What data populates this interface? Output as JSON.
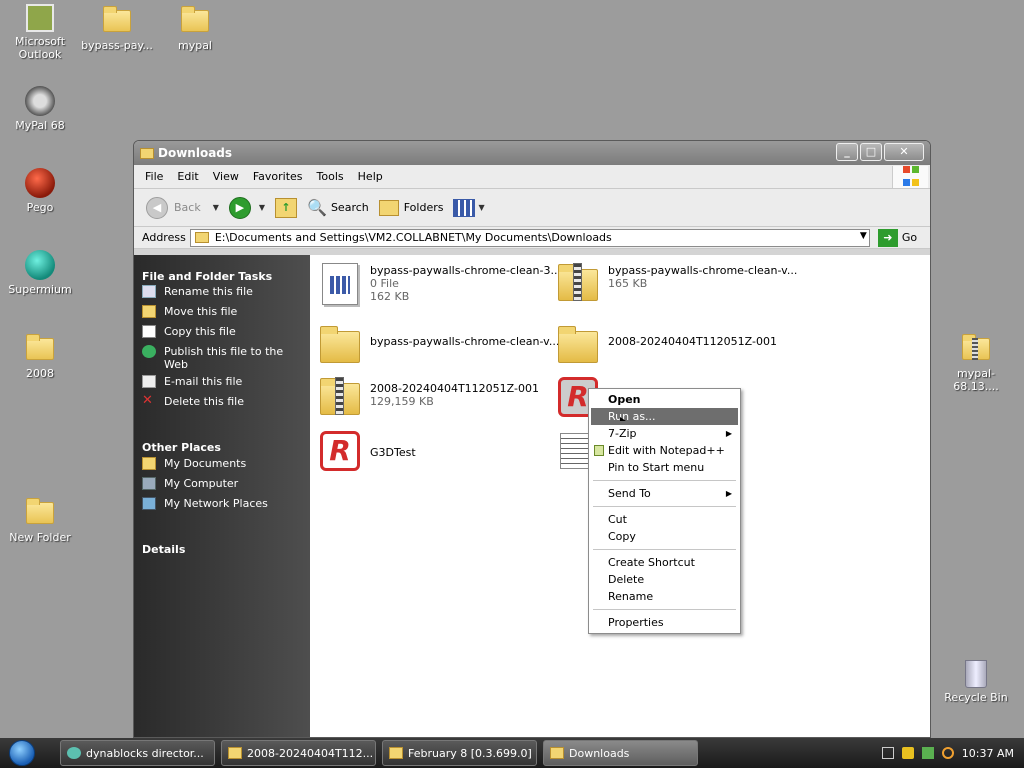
{
  "desktop": {
    "icons": [
      {
        "label": "Microsoft Outlook"
      },
      {
        "label": "bypass-pay..."
      },
      {
        "label": "mypal"
      },
      {
        "label": "MyPal 68"
      },
      {
        "label": "Pego"
      },
      {
        "label": "Supermium"
      },
      {
        "label": "2008"
      },
      {
        "label": "New Folder"
      },
      {
        "label": "mypal-68.13...."
      },
      {
        "label": "Recycle Bin"
      }
    ]
  },
  "window": {
    "title": "Downloads",
    "menu": [
      "File",
      "Edit",
      "View",
      "Favorites",
      "Tools",
      "Help"
    ],
    "toolbar": {
      "back": "Back",
      "search": "Search",
      "folders": "Folders"
    },
    "address": {
      "label": "Address",
      "value": "E:\\Documents and Settings\\VM2.COLLABNET\\My Documents\\Downloads",
      "go": "Go"
    },
    "sidebar": {
      "tasks_title": "File and Folder Tasks",
      "tasks": [
        "Rename this file",
        "Move this file",
        "Copy this file",
        "Publish this file to the Web",
        "E-mail this file",
        "Delete this file"
      ],
      "places_title": "Other Places",
      "places": [
        "My Documents",
        "My Computer",
        "My Network Places"
      ],
      "details_title": "Details"
    },
    "files": [
      {
        "name": "bypass-paywalls-chrome-clean-3....",
        "line2": "0 File",
        "line3": "162 KB"
      },
      {
        "name": "bypass-paywalls-chrome-clean-v...",
        "line2": "165 KB"
      },
      {
        "name": "bypass-paywalls-chrome-clean-v..."
      },
      {
        "name": "2008-20240404T112051Z-001"
      },
      {
        "name": "2008-20240404T112051Z-001",
        "line2": "129,159 KB"
      },
      {
        "name": "G3DTest"
      }
    ]
  },
  "context_menu": {
    "items": [
      "Open",
      "Run as...",
      "7-Zip",
      "Edit with Notepad++",
      "Pin to Start menu",
      "Send To",
      "Cut",
      "Copy",
      "Create Shortcut",
      "Delete",
      "Rename",
      "Properties"
    ]
  },
  "taskbar": {
    "tasks": [
      "dynablocks director...",
      "2008-20240404T112...",
      "February 8 [0.3.699.0]",
      "Downloads"
    ],
    "clock": "10:37 AM"
  },
  "colors": {
    "accent": "#6e6e6e",
    "folder": "#f2d572",
    "go_green": "#2e9c2e"
  }
}
